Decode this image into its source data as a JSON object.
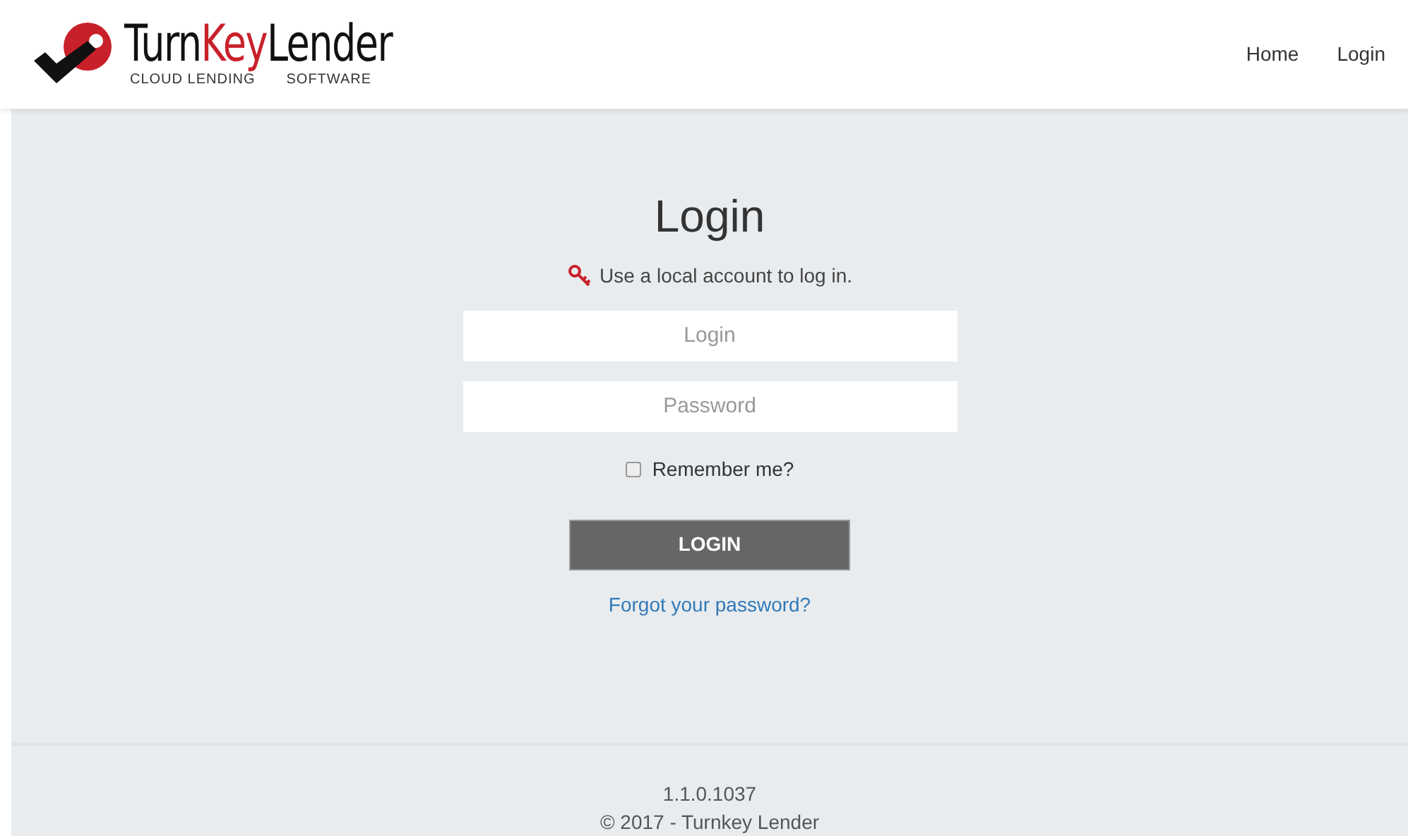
{
  "logo": {
    "word_1": "Turn",
    "word_2": "Key",
    "word_3": "Lender",
    "tagline_1": "CLOUD LENDING",
    "tagline_2": "SOFTWARE"
  },
  "nav": [
    {
      "label": "Home"
    },
    {
      "label": "Login"
    }
  ],
  "form": {
    "title": "Login",
    "hint": "Use a local account to log in.",
    "login": {
      "placeholder": "Login"
    },
    "password": {
      "placeholder": "Password"
    },
    "remember": {
      "label": "Remember me?",
      "checked": false
    },
    "submit": "LOGIN",
    "forgot": "Forgot your password?"
  },
  "footer": {
    "version": "1.1.0.1037",
    "copyright": "© 2017 - Turnkey Lender"
  }
}
